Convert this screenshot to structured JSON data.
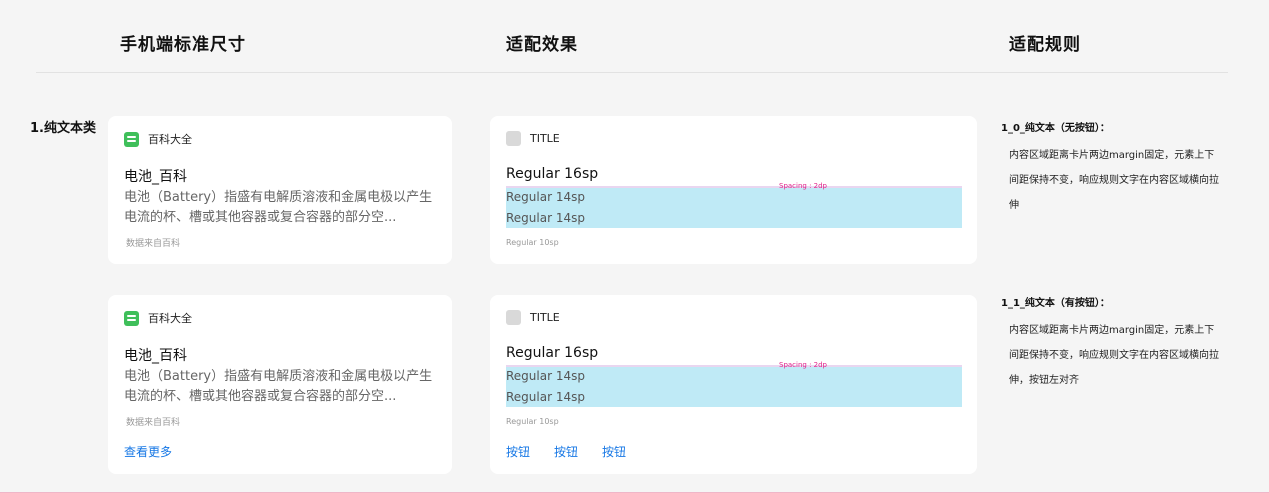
{
  "columns": {
    "standard": "手机端标准尺寸",
    "effect": "适配效果",
    "rules": "适配规则"
  },
  "section_label": "1.纯文本类",
  "rows": [
    {
      "standard": {
        "app_icon": "green-list-icon",
        "app_name": "百科大全",
        "title": "电池_百科",
        "desc": "电池（Battery）指盛有电解质溶液和金属电极以产生电流的杯、槽或其他容器或复合容器的部分空...",
        "source": "数据来自百科"
      },
      "effect": {
        "placeholder_title": "TITLE",
        "line_16": "Regular 16sp",
        "spacing_label": "Spacing : 2dp",
        "line_14a": "Regular 14sp",
        "line_14b": "Regular 14sp",
        "line_10": "Regular 10sp"
      },
      "rule": {
        "title": "1_0_纯文本（无按钮）：",
        "text": "内容区域距离卡片两边margin固定，元素上下间距保持不变，响应规则文字在内容区域横向拉伸"
      }
    },
    {
      "standard": {
        "app_icon": "green-list-icon",
        "app_name": "百科大全",
        "title": "电池_百科",
        "desc": "电池（Battery）指盛有电解质溶液和金属电极以产生电流的杯、槽或其他容器或复合容器的部分空...",
        "source": "数据来自百科",
        "more_link": "查看更多"
      },
      "effect": {
        "placeholder_title": "TITLE",
        "line_16": "Regular 16sp",
        "spacing_label": "Spacing : 2dp",
        "line_14a": "Regular 14sp",
        "line_14b": "Regular 14sp",
        "line_10": "Regular 10sp",
        "buttons": [
          "按钮",
          "按钮",
          "按钮"
        ]
      },
      "rule": {
        "title": "1_1_纯文本（有按钮）：",
        "text": "内容区域距离卡片两边margin固定，元素上下间距保持不变，响应规则文字在内容区域横向拉伸，按钮左对齐"
      }
    }
  ],
  "colors": {
    "accent_blue": "#1677e5",
    "icon_green": "#3fbf5a",
    "highlight": "#bfeaf6",
    "spacing_pink": "#e0238a"
  }
}
